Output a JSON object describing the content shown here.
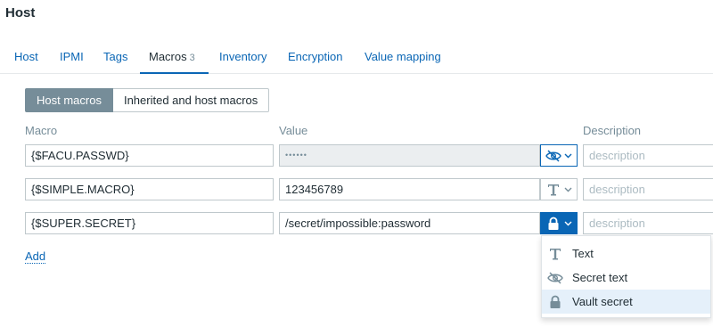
{
  "page": {
    "title": "Host"
  },
  "tabs": [
    {
      "label": "Host"
    },
    {
      "label": "IPMI"
    },
    {
      "label": "Tags"
    },
    {
      "label": "Macros",
      "count": "3"
    },
    {
      "label": "Inventory"
    },
    {
      "label": "Encryption"
    },
    {
      "label": "Value mapping"
    }
  ],
  "active_tab": "Macros",
  "view_toggle": {
    "host_macros": "Host macros",
    "inherited": "Inherited and host macros",
    "selected": "Host macros"
  },
  "columns": {
    "macro": "Macro",
    "value": "Value",
    "description": "Description"
  },
  "rows": [
    {
      "macro": "{$FACU.PASSWD}",
      "value": "••••••",
      "value_type": "Secret text",
      "type_icon": "eye-slash-icon",
      "description_placeholder": "description"
    },
    {
      "macro": "{$SIMPLE.MACRO}",
      "value": "123456789",
      "value_type": "Text",
      "type_icon": "text-t-icon",
      "description_placeholder": "description"
    },
    {
      "macro": "{$SUPER.SECRET}",
      "value": "/secret/impossible:password",
      "value_type": "Vault secret",
      "type_icon": "lock-icon",
      "description_placeholder": "description"
    }
  ],
  "add_label": "Add",
  "type_menu": {
    "items": [
      {
        "label": "Text",
        "icon": "text-t-icon"
      },
      {
        "label": "Secret text",
        "icon": "eye-slash-icon"
      },
      {
        "label": "Vault secret",
        "icon": "lock-icon"
      }
    ],
    "highlighted": "Vault secret"
  },
  "colors": {
    "accent": "#0a66b5",
    "muted": "#768d99",
    "highlight": "#e5f0fa"
  }
}
